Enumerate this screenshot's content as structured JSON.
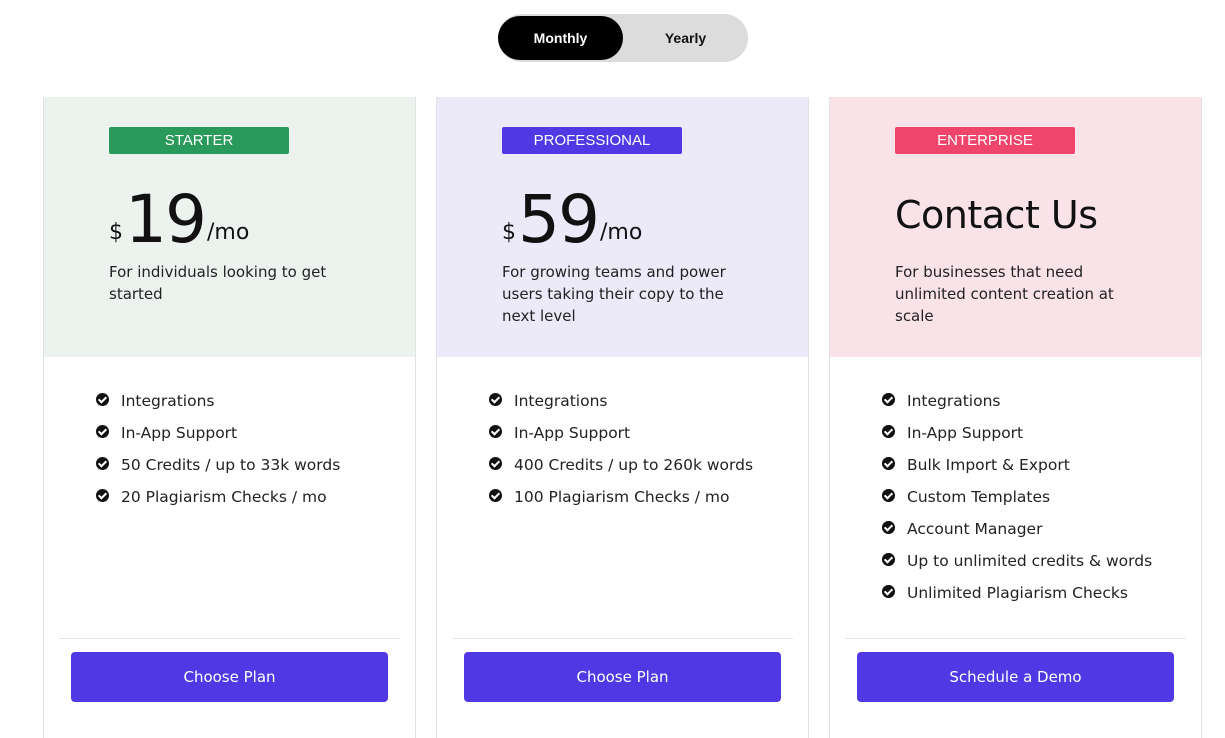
{
  "billing_toggle": {
    "options": [
      "Monthly",
      "Yearly"
    ],
    "selected": "Monthly"
  },
  "plans": [
    {
      "badge": "STARTER",
      "badge_color": "#2a9a5a",
      "bg_color": "#ecf3ef",
      "currency": "$",
      "price": "19",
      "period": "/mo",
      "description": "For individuals looking to get started",
      "features": [
        "Integrations",
        "In-App Support",
        "50 Credits / up to 33k words",
        "20 Plagiarism Checks / mo"
      ],
      "cta": "Choose Plan"
    },
    {
      "badge": "PROFESSIONAL",
      "badge_color": "#5038e4",
      "bg_color": "#ece9f9",
      "currency": "$",
      "price": "59",
      "period": "/mo",
      "description": "For growing teams and power users taking their copy to the next level",
      "features": [
        "Integrations",
        "In-App Support",
        "400 Credits / up to 260k words",
        "100 Plagiarism Checks / mo"
      ],
      "cta": "Choose Plan"
    },
    {
      "badge": "ENTERPRISE",
      "badge_color": "#ef446c",
      "bg_color": "#f9e3e8",
      "headline": "Contact Us",
      "description": "For businesses that need unlimited content creation at scale",
      "features": [
        "Integrations",
        "In-App Support",
        "Bulk Import & Export",
        "Custom Templates",
        "Account Manager",
        "Up to unlimited credits & words",
        "Unlimited Plagiarism Checks"
      ],
      "cta": "Schedule a Demo"
    }
  ],
  "colors": {
    "cta_bg": "#5038e4",
    "toggle_active_bg": "#000000",
    "toggle_track": "#dcdcdc"
  }
}
